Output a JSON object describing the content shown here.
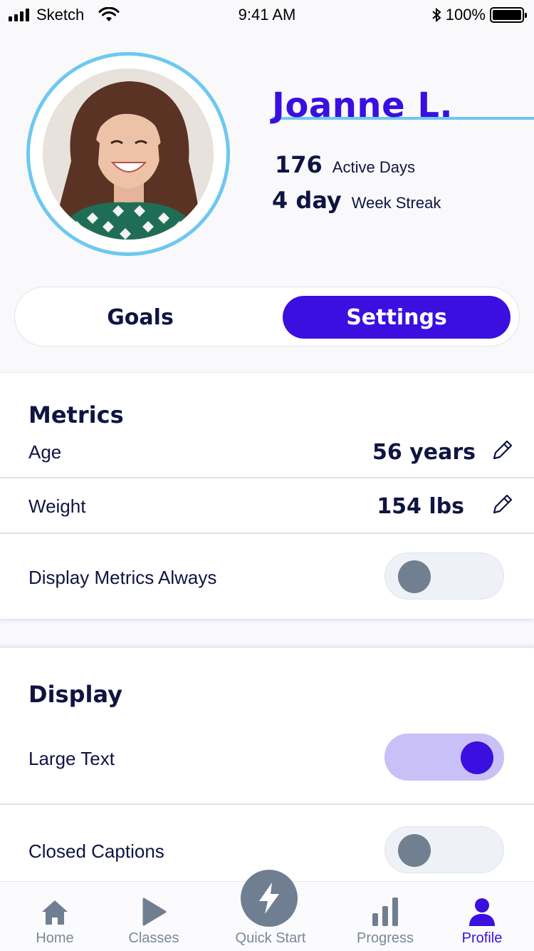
{
  "status_bar": {
    "carrier": "Sketch",
    "time": "9:41 AM",
    "battery_percent": "100%",
    "icons": [
      "signal-icon",
      "wifi-icon",
      "bluetooth-icon",
      "battery-icon"
    ]
  },
  "profile": {
    "name": "Joanne L.",
    "stats": [
      {
        "value": "176",
        "label": "Active Days"
      },
      {
        "value": "4 day",
        "label": "Week Streak"
      }
    ]
  },
  "segmented": {
    "goals_label": "Goals",
    "settings_label": "Settings",
    "selected": "Settings"
  },
  "metrics": {
    "title": "Metrics",
    "age_label": "Age",
    "age_value": "56 years",
    "weight_label": "Weight",
    "weight_value": "154 lbs",
    "display_always_label": "Display Metrics Always",
    "display_always_on": false
  },
  "display": {
    "title": "Display",
    "large_text_label": "Large Text",
    "large_text_on": true,
    "captions_label": "Closed Captions",
    "captions_on": false
  },
  "tabs": [
    {
      "label": "Home",
      "icon": "home-icon",
      "active": false
    },
    {
      "label": "Classes",
      "icon": "play-icon",
      "active": false
    },
    {
      "label": "Quick Start",
      "icon": "lightning-icon",
      "active": false
    },
    {
      "label": "Progress",
      "icon": "bar-chart-icon",
      "active": false
    },
    {
      "label": "Profile",
      "icon": "person-icon",
      "active": true
    }
  ],
  "colors": {
    "accent": "#3a0fe0",
    "ring": "#6ec8f0",
    "text": "#0f1442",
    "toggle_on_track": "#c8c0f6",
    "inactive": "#7a8898"
  }
}
